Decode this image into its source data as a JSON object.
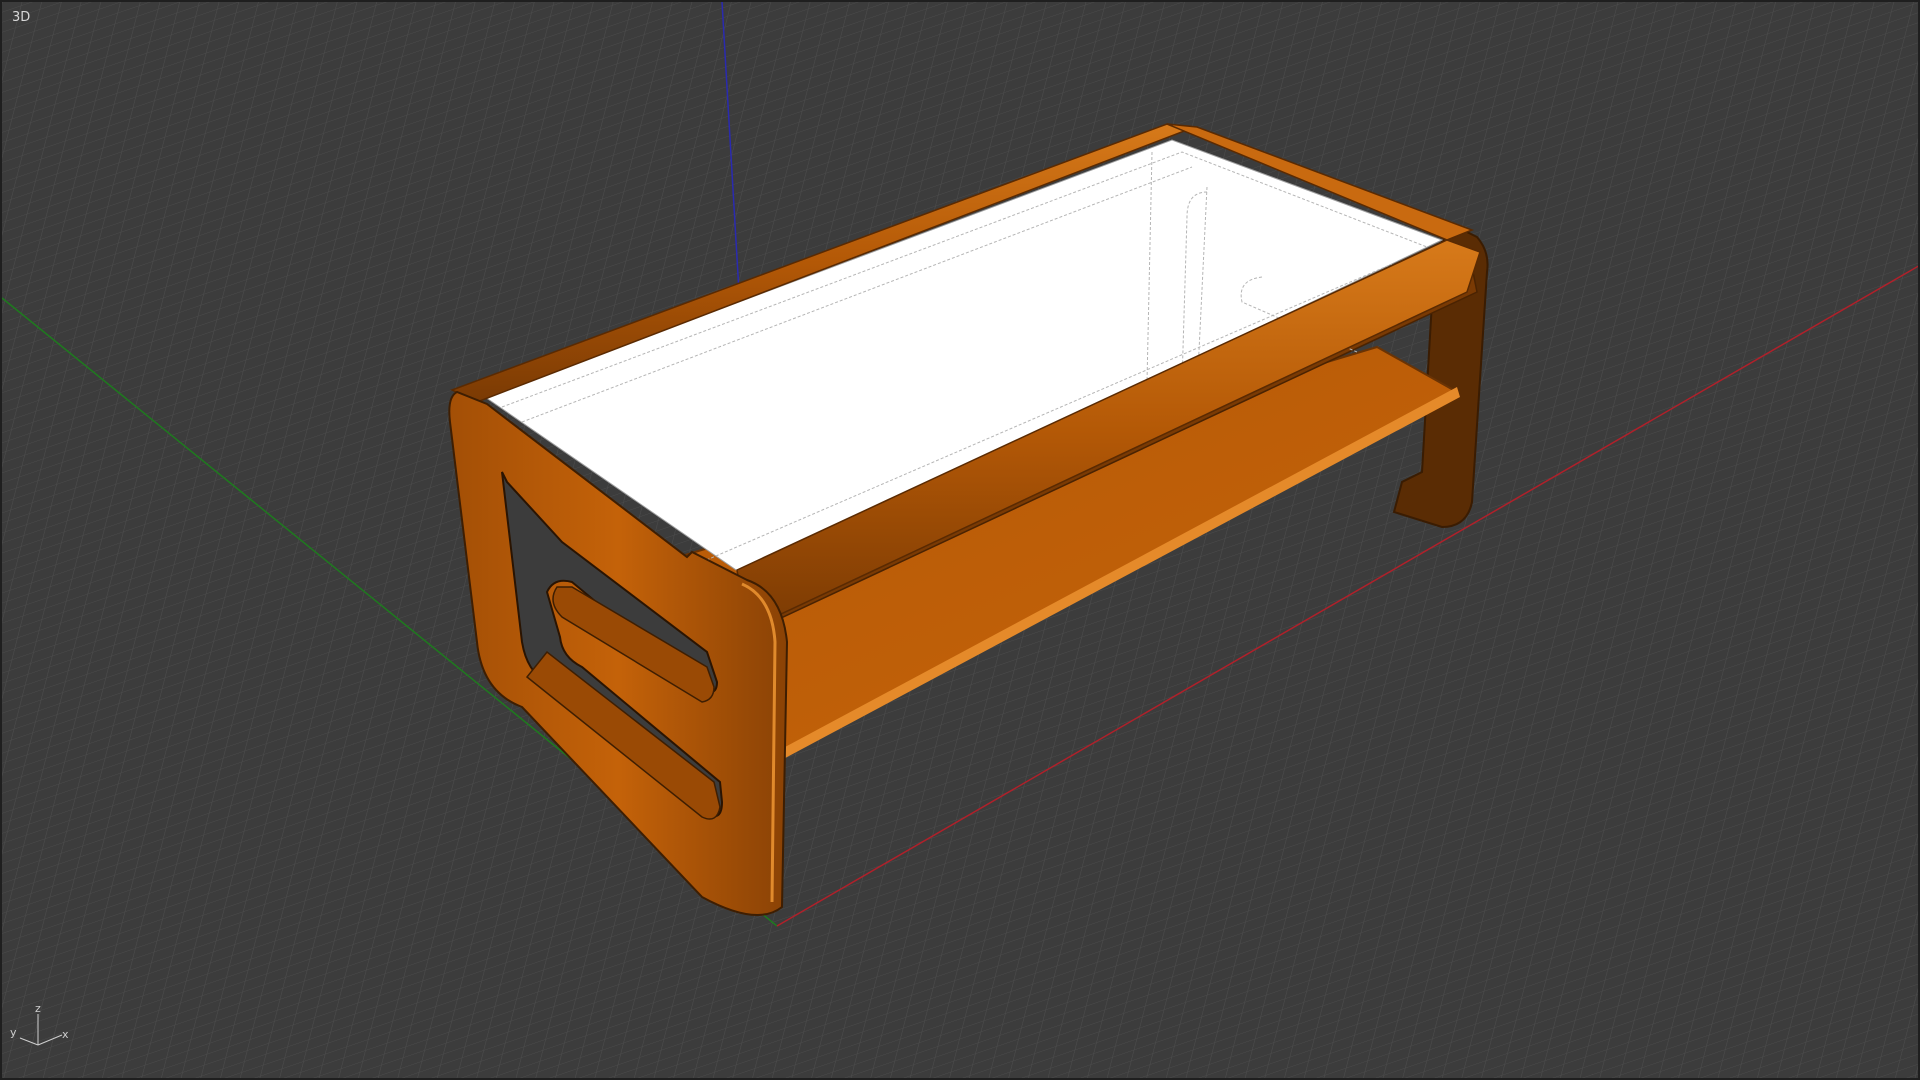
{
  "viewport": {
    "view_label": "3D",
    "background_color": "#3c3c3c",
    "grid_color": "#4a4a4a",
    "axis_colors": {
      "x": "#b0202a",
      "y": "#1e7a1e",
      "z": "#2a2ab0"
    }
  },
  "model": {
    "name": "coffee-table",
    "wood_color": "#b95a05",
    "glass_color": "#ffffff"
  },
  "axis_triad": {
    "x_label": "x",
    "y_label": "y",
    "z_label": "z"
  }
}
